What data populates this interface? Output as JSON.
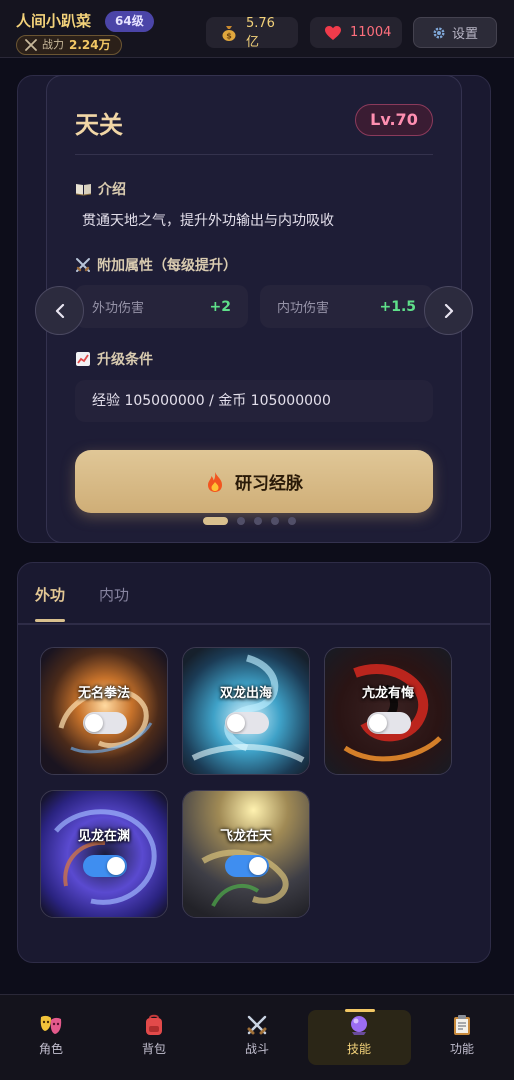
{
  "header": {
    "player_name": "人间小趴菜",
    "level_badge": "64级",
    "power_label": "战力",
    "power_value": "2.24万",
    "gold": "5.76亿",
    "hearts": "11004",
    "settings_label": "设置"
  },
  "skill_detail": {
    "title": "天关",
    "level": "Lv.70",
    "intro_heading": "介绍",
    "intro_text": "贯通天地之气，提升外功输出与内功吸收",
    "attr_heading": "附加属性（每级提升）",
    "attributes": [
      {
        "label": "外功伤害",
        "value": "+2"
      },
      {
        "label": "内功伤害",
        "value": "+1.5"
      }
    ],
    "upgrade_heading": "升级条件",
    "upgrade_text": "经验 105000000 / 金币 105000000",
    "action_label": "研习经脉",
    "page_count": 5,
    "active_page": 1
  },
  "tabs": [
    {
      "label": "外功",
      "active": true
    },
    {
      "label": "内功",
      "active": false
    }
  ],
  "skills": [
    {
      "name": "无名拳法",
      "enabled": false
    },
    {
      "name": "双龙出海",
      "enabled": false
    },
    {
      "name": "亢龙有悔",
      "enabled": false
    },
    {
      "name": "见龙在渊",
      "enabled": true
    },
    {
      "name": "飞龙在天",
      "enabled": true
    }
  ],
  "bottom_nav": [
    {
      "label": "角色",
      "icon": "mask-icon",
      "active": false
    },
    {
      "label": "背包",
      "icon": "backpack-icon",
      "active": false
    },
    {
      "label": "战斗",
      "icon": "crossed-swords-icon",
      "active": false
    },
    {
      "label": "技能",
      "icon": "crystal-ball-icon",
      "active": true
    },
    {
      "label": "功能",
      "icon": "clipboard-icon",
      "active": false
    }
  ],
  "colors": {
    "accent_gold": "#d9c08e",
    "level_badge": "#4b45a8",
    "attr_positive": "#5fe08a",
    "toggle_on": "#3f8ef0",
    "level_pill_text": "#ff8fb1"
  }
}
